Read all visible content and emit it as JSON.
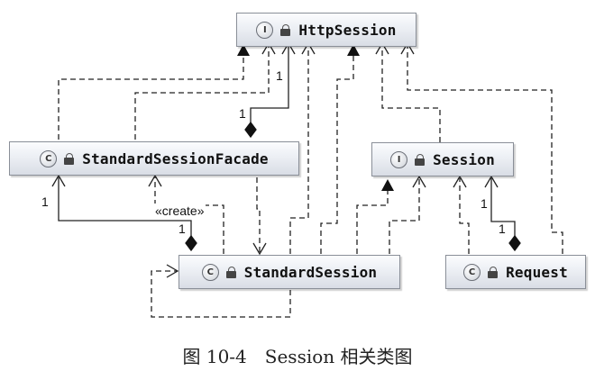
{
  "nodes": {
    "http_session": {
      "kind": "I",
      "name": "HttpSession"
    },
    "facade": {
      "kind": "C",
      "name": "StandardSessionFacade"
    },
    "session": {
      "kind": "I",
      "name": "Session"
    },
    "standard_session": {
      "kind": "C",
      "name": "StandardSession"
    },
    "request": {
      "kind": "C",
      "name": "Request"
    }
  },
  "labels": {
    "mult_top": "1",
    "mult_mid": "1",
    "mult_facade": "1",
    "mult_std": "1",
    "mult_request_a": "1",
    "mult_request_b": "1",
    "create": "«create»"
  },
  "caption": "图 10-4　Session 相关类图"
}
